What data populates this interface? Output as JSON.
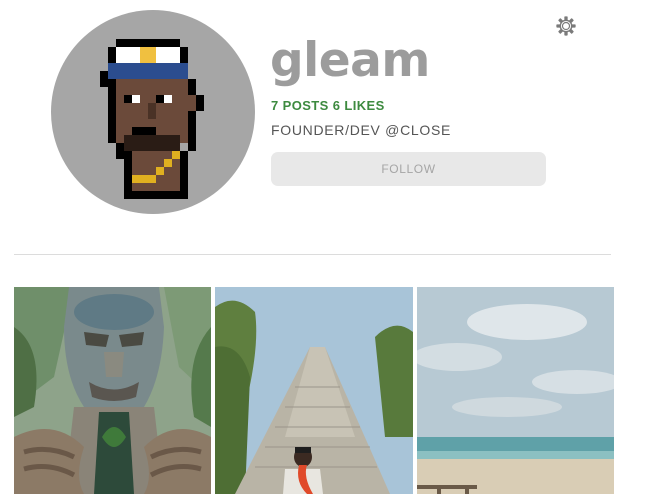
{
  "profile": {
    "username": "gleam",
    "stats": "7 POSTS 6 LIKES",
    "bio": "FOUNDER/DEV @CLOSE",
    "follow_label": "FOLLOW",
    "avatar_icon": "pixel-art-avatar",
    "settings_icon": "gear-icon"
  },
  "colors": {
    "username": "#9c9c9c",
    "stats": "#3d8a3f",
    "avatar_bg": "#a6a6a6",
    "follow_bg": "#e8e8e8"
  },
  "posts": [
    {
      "content": "carved wooden statue among tropical plants"
    },
    {
      "content": "person in front of stone pyramid ruins"
    },
    {
      "content": "beach under a cloudy sky"
    }
  ]
}
